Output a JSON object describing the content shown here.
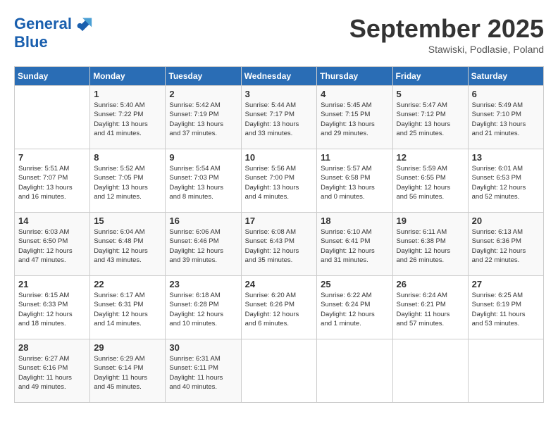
{
  "header": {
    "logo_line1": "General",
    "logo_line2": "Blue",
    "month": "September 2025",
    "location": "Stawiski, Podlasie, Poland"
  },
  "days_of_week": [
    "Sunday",
    "Monday",
    "Tuesday",
    "Wednesday",
    "Thursday",
    "Friday",
    "Saturday"
  ],
  "weeks": [
    [
      {
        "day": "",
        "info": ""
      },
      {
        "day": "1",
        "info": "Sunrise: 5:40 AM\nSunset: 7:22 PM\nDaylight: 13 hours\nand 41 minutes."
      },
      {
        "day": "2",
        "info": "Sunrise: 5:42 AM\nSunset: 7:19 PM\nDaylight: 13 hours\nand 37 minutes."
      },
      {
        "day": "3",
        "info": "Sunrise: 5:44 AM\nSunset: 7:17 PM\nDaylight: 13 hours\nand 33 minutes."
      },
      {
        "day": "4",
        "info": "Sunrise: 5:45 AM\nSunset: 7:15 PM\nDaylight: 13 hours\nand 29 minutes."
      },
      {
        "day": "5",
        "info": "Sunrise: 5:47 AM\nSunset: 7:12 PM\nDaylight: 13 hours\nand 25 minutes."
      },
      {
        "day": "6",
        "info": "Sunrise: 5:49 AM\nSunset: 7:10 PM\nDaylight: 13 hours\nand 21 minutes."
      }
    ],
    [
      {
        "day": "7",
        "info": "Sunrise: 5:51 AM\nSunset: 7:07 PM\nDaylight: 13 hours\nand 16 minutes."
      },
      {
        "day": "8",
        "info": "Sunrise: 5:52 AM\nSunset: 7:05 PM\nDaylight: 13 hours\nand 12 minutes."
      },
      {
        "day": "9",
        "info": "Sunrise: 5:54 AM\nSunset: 7:03 PM\nDaylight: 13 hours\nand 8 minutes."
      },
      {
        "day": "10",
        "info": "Sunrise: 5:56 AM\nSunset: 7:00 PM\nDaylight: 13 hours\nand 4 minutes."
      },
      {
        "day": "11",
        "info": "Sunrise: 5:57 AM\nSunset: 6:58 PM\nDaylight: 13 hours\nand 0 minutes."
      },
      {
        "day": "12",
        "info": "Sunrise: 5:59 AM\nSunset: 6:55 PM\nDaylight: 12 hours\nand 56 minutes."
      },
      {
        "day": "13",
        "info": "Sunrise: 6:01 AM\nSunset: 6:53 PM\nDaylight: 12 hours\nand 52 minutes."
      }
    ],
    [
      {
        "day": "14",
        "info": "Sunrise: 6:03 AM\nSunset: 6:50 PM\nDaylight: 12 hours\nand 47 minutes."
      },
      {
        "day": "15",
        "info": "Sunrise: 6:04 AM\nSunset: 6:48 PM\nDaylight: 12 hours\nand 43 minutes."
      },
      {
        "day": "16",
        "info": "Sunrise: 6:06 AM\nSunset: 6:46 PM\nDaylight: 12 hours\nand 39 minutes."
      },
      {
        "day": "17",
        "info": "Sunrise: 6:08 AM\nSunset: 6:43 PM\nDaylight: 12 hours\nand 35 minutes."
      },
      {
        "day": "18",
        "info": "Sunrise: 6:10 AM\nSunset: 6:41 PM\nDaylight: 12 hours\nand 31 minutes."
      },
      {
        "day": "19",
        "info": "Sunrise: 6:11 AM\nSunset: 6:38 PM\nDaylight: 12 hours\nand 26 minutes."
      },
      {
        "day": "20",
        "info": "Sunrise: 6:13 AM\nSunset: 6:36 PM\nDaylight: 12 hours\nand 22 minutes."
      }
    ],
    [
      {
        "day": "21",
        "info": "Sunrise: 6:15 AM\nSunset: 6:33 PM\nDaylight: 12 hours\nand 18 minutes."
      },
      {
        "day": "22",
        "info": "Sunrise: 6:17 AM\nSunset: 6:31 PM\nDaylight: 12 hours\nand 14 minutes."
      },
      {
        "day": "23",
        "info": "Sunrise: 6:18 AM\nSunset: 6:28 PM\nDaylight: 12 hours\nand 10 minutes."
      },
      {
        "day": "24",
        "info": "Sunrise: 6:20 AM\nSunset: 6:26 PM\nDaylight: 12 hours\nand 6 minutes."
      },
      {
        "day": "25",
        "info": "Sunrise: 6:22 AM\nSunset: 6:24 PM\nDaylight: 12 hours\nand 1 minute."
      },
      {
        "day": "26",
        "info": "Sunrise: 6:24 AM\nSunset: 6:21 PM\nDaylight: 11 hours\nand 57 minutes."
      },
      {
        "day": "27",
        "info": "Sunrise: 6:25 AM\nSunset: 6:19 PM\nDaylight: 11 hours\nand 53 minutes."
      }
    ],
    [
      {
        "day": "28",
        "info": "Sunrise: 6:27 AM\nSunset: 6:16 PM\nDaylight: 11 hours\nand 49 minutes."
      },
      {
        "day": "29",
        "info": "Sunrise: 6:29 AM\nSunset: 6:14 PM\nDaylight: 11 hours\nand 45 minutes."
      },
      {
        "day": "30",
        "info": "Sunrise: 6:31 AM\nSunset: 6:11 PM\nDaylight: 11 hours\nand 40 minutes."
      },
      {
        "day": "",
        "info": ""
      },
      {
        "day": "",
        "info": ""
      },
      {
        "day": "",
        "info": ""
      },
      {
        "day": "",
        "info": ""
      }
    ]
  ]
}
